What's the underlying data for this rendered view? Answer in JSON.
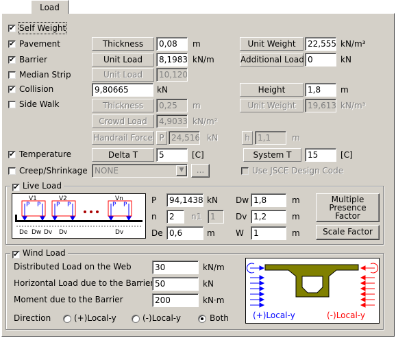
{
  "tab": {
    "label": "Load"
  },
  "self_weight": {
    "label": "Self Weight",
    "checked": true
  },
  "pavement": {
    "label": "Pavement",
    "checked": true,
    "thickness_label": "Thickness",
    "thickness": "0,08",
    "thickness_unit": "m",
    "unit_weight_label": "Unit Weight",
    "unit_weight": "22,5552",
    "unit_weight_unit": "kN/m³"
  },
  "barrier": {
    "label": "Barrier",
    "checked": true,
    "unit_load_label": "Unit Load",
    "unit_load": "8,19835",
    "unit_load_unit": "kN/m",
    "additional_load_label": "Additional Load",
    "additional_load": "0",
    "additional_load_unit": "kN"
  },
  "median_strip": {
    "label": "Median Strip",
    "checked": false,
    "unit_load_label": "Unit Load",
    "unit_load": "10,1204"
  },
  "collision": {
    "label": "Collision",
    "checked": true,
    "value": "9,80665",
    "unit": "kN",
    "height_label": "Height",
    "height": "1,8",
    "height_unit": "m"
  },
  "side_walk": {
    "label": "Side Walk",
    "checked": false,
    "thickness_label": "Thickness",
    "thickness": "0,25",
    "thickness_unit": "m",
    "unit_weight_label": "Unit Weight",
    "unit_weight": "19,6133",
    "unit_weight_unit": "kN/m³",
    "crowd_load_label": "Crowd Load",
    "crowd_load": "4,90332",
    "crowd_load_unit": "kN/m²",
    "handrail_force_label": "Handrail Force",
    "handrail_p_label": "P",
    "handrail_p": "24,5166",
    "handrail_p_unit": "kN",
    "handrail_h_label": "h",
    "handrail_h": "1,1",
    "handrail_h_unit": "m"
  },
  "temperature": {
    "label": "Temperature",
    "checked": true,
    "delta_t_label": "Delta T",
    "delta_t": "5",
    "delta_t_unit": "[C]",
    "system_t_label": "System T",
    "system_t": "15",
    "system_t_unit": "[C]"
  },
  "creep": {
    "label": "Creep/Shrinkage",
    "checked": false,
    "select_value": "NONE",
    "browse_label": "...",
    "jsce_label": "Use JSCE Design Code"
  },
  "live_load": {
    "title": "Live Load",
    "checked": true,
    "p_label": "P",
    "p": "94,14384",
    "p_unit": "kN",
    "n_label": "n",
    "n": "2",
    "n1_label": "n1",
    "n1": "1",
    "de_label": "De",
    "de": "0,6",
    "de_unit": "m",
    "dw_label": "Dw",
    "dw": "1,8",
    "dw_unit": "m",
    "dv_label": "Dv",
    "dv": "1,2",
    "dv_unit": "m",
    "w_label": "W",
    "w": "1",
    "w_unit": "m",
    "multiple_presence_label": "Multiple Presence Factor",
    "scale_factor_label": "Scale Factor",
    "diagram": {
      "v1": "V1",
      "v2": "V2",
      "vn": "Vn",
      "p": "P",
      "de": "De",
      "dw": "Dw",
      "dv": "Dv",
      "dv2": "Dv",
      "dv3": "Dv"
    }
  },
  "wind_load": {
    "title": "Wind Load",
    "checked": true,
    "distributed_label": "Distributed Load on the Web",
    "distributed": "30",
    "distributed_unit": "kN/m",
    "horizontal_label": "Horizontal Load due to the Barrier",
    "horizontal": "50",
    "horizontal_unit": "kN",
    "moment_label": "Moment due to the Barrier",
    "moment": "200",
    "moment_unit": "kN·m",
    "direction_label": "Direction",
    "options": [
      {
        "label": "(+)Local-y",
        "selected": false
      },
      {
        "label": "(-)Local-y",
        "selected": false
      },
      {
        "label": "Both",
        "selected": true
      }
    ],
    "diagram": {
      "plus_label": "(+)Local-y",
      "minus_label": "(-)Local-y"
    }
  },
  "colors": {
    "blue": "#0000ff",
    "red": "#ff0000",
    "girder": "#808000"
  }
}
